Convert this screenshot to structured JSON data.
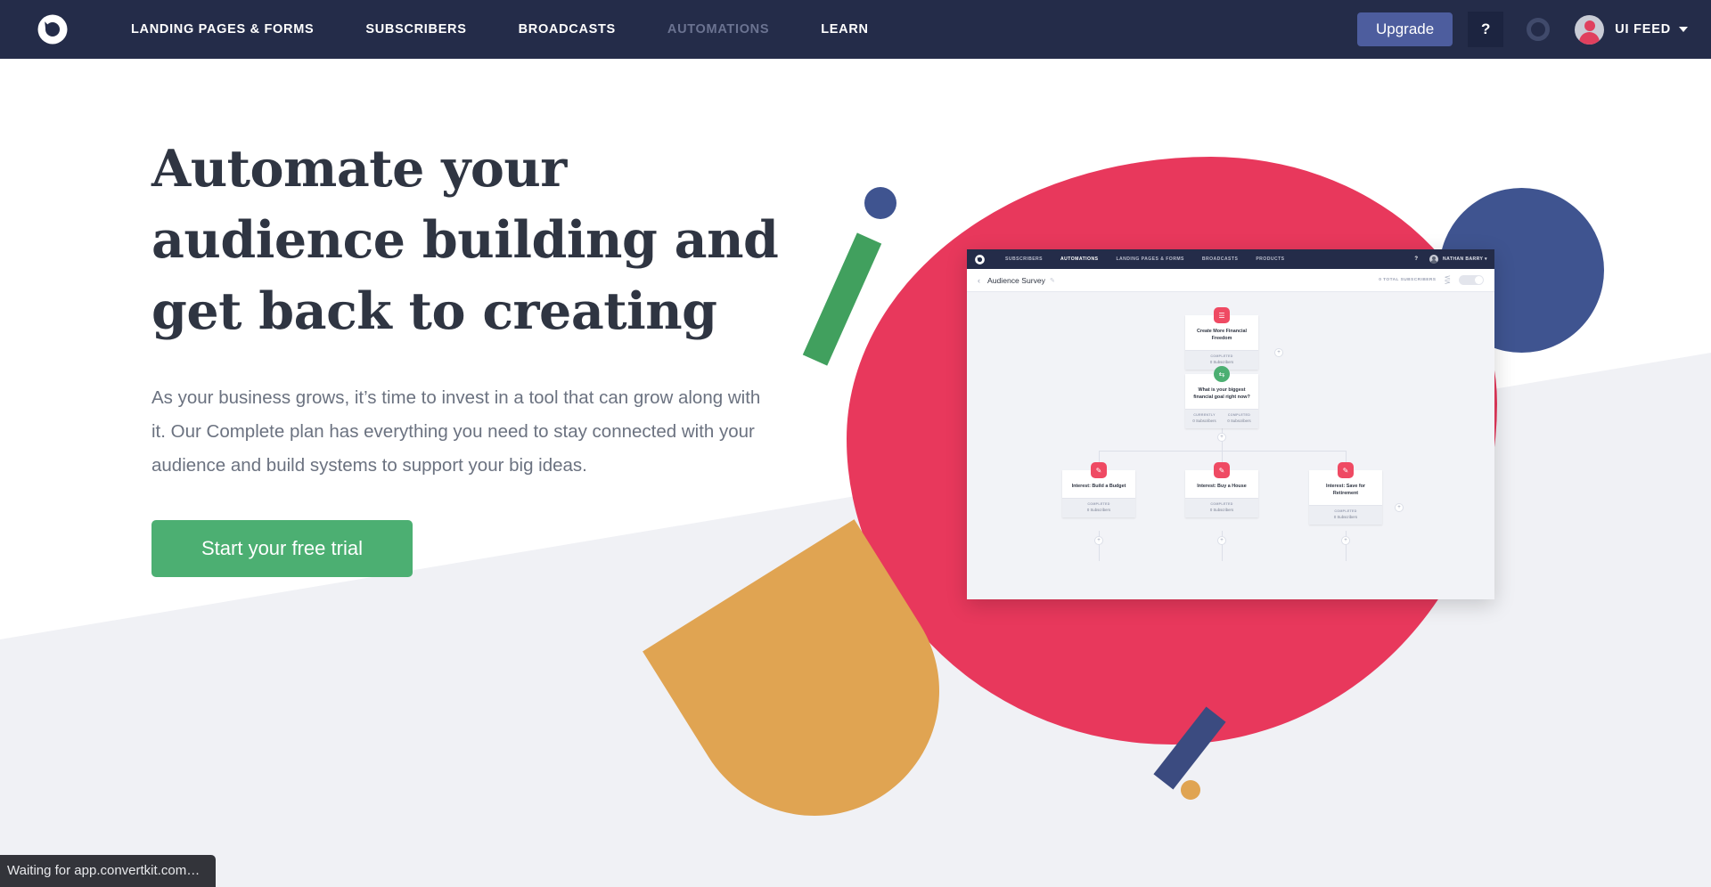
{
  "topnav": {
    "logo_icon": "convertkit-logo-icon",
    "links": [
      {
        "label": "LANDING PAGES & FORMS",
        "muted": false
      },
      {
        "label": "SUBSCRIBERS",
        "muted": false
      },
      {
        "label": "BROADCASTS",
        "muted": false
      },
      {
        "label": "AUTOMATIONS",
        "muted": true
      },
      {
        "label": "LEARN",
        "muted": false
      }
    ],
    "upgrade_label": "Upgrade",
    "help_label": "?",
    "status_ring_icon": "loading-ring-icon",
    "account_name": "UI FEED",
    "caret_icon": "chevron-down-icon",
    "bg_color": "#242c49",
    "upgrade_color": "#4d5d9e"
  },
  "hero": {
    "headline_line1": "Automate your",
    "headline_line2": "audience building and",
    "headline_line3": "get back to creating",
    "subcopy": "As your business grows, it’s time to invest in a tool that can grow along with it. Our Complete plan has everything you need to stay connected with your audience and build systems to support your big ideas.",
    "cta_label": "Start your free trial",
    "cta_color": "#4caf72",
    "headline_color": "#2f3542"
  },
  "illustration": {
    "shapes": [
      {
        "name": "red-blob",
        "color": "#e8385c"
      },
      {
        "name": "blue-circle-large",
        "color": "#3f5490"
      },
      {
        "name": "blue-circle-small",
        "color": "#3f5490"
      },
      {
        "name": "green-bar",
        "color": "#41a05e"
      },
      {
        "name": "orange-wedge",
        "color": "#e0a452"
      },
      {
        "name": "navy-bar",
        "color": "#3b4b80"
      },
      {
        "name": "orange-dot",
        "color": "#e0a452"
      }
    ]
  },
  "app_screenshot": {
    "nav": {
      "logo_icon": "convertkit-logo-icon",
      "links": [
        {
          "label": "SUBSCRIBERS",
          "active": false
        },
        {
          "label": "AUTOMATIONS",
          "active": true
        },
        {
          "label": "LANDING PAGES & FORMS",
          "active": false
        },
        {
          "label": "BROADCASTS",
          "active": false
        },
        {
          "label": "PRODUCTS",
          "active": false
        }
      ],
      "help_label": "?",
      "user_name": "NATHAN BARRY ▾"
    },
    "subheader": {
      "back_icon": "chevron-left-icon",
      "title": "Audience Survey",
      "edit_icon": "pencil-icon",
      "total_subscribers": "0 TOTAL SUBSCRIBERS",
      "share_icon": "share-icon",
      "toggle_icon": "toggle-off"
    },
    "nodes": [
      {
        "title": "Create More Financial Freedom",
        "icon": "tag-icon",
        "icon_color": "#ef4a63",
        "icon_style": "red",
        "stats": [
          {
            "label": "COMPLETED",
            "value": "0 Subscribers"
          }
        ]
      },
      {
        "title": "What is your biggest financial goal right now?",
        "icon": "branch-icon",
        "icon_color": "#4caf72",
        "icon_style": "green",
        "stats": [
          {
            "label": "CURRENTLY",
            "value": "0 Subscribers"
          },
          {
            "label": "COMPLETED",
            "value": "0 Subscribers"
          }
        ]
      },
      {
        "title": "Interest: Build a Budget",
        "icon": "tag-icon",
        "icon_color": "#ef4a63",
        "icon_style": "red",
        "stats": [
          {
            "label": "COMPLETED",
            "value": "0 Subscribers"
          }
        ]
      },
      {
        "title": "Interest: Buy a House",
        "icon": "tag-icon",
        "icon_color": "#ef4a63",
        "icon_style": "red",
        "stats": [
          {
            "label": "COMPLETED",
            "value": "0 Subscribers"
          }
        ]
      },
      {
        "title": "Interest: Save for Retirement",
        "icon": "tag-icon",
        "icon_color": "#ef4a63",
        "icon_style": "red",
        "stats": [
          {
            "label": "COMPLETED",
            "value": "0 Subscribers"
          }
        ]
      }
    ],
    "add_button_label": "+"
  },
  "statusbar": {
    "text": "Waiting for app.convertkit.com…"
  }
}
